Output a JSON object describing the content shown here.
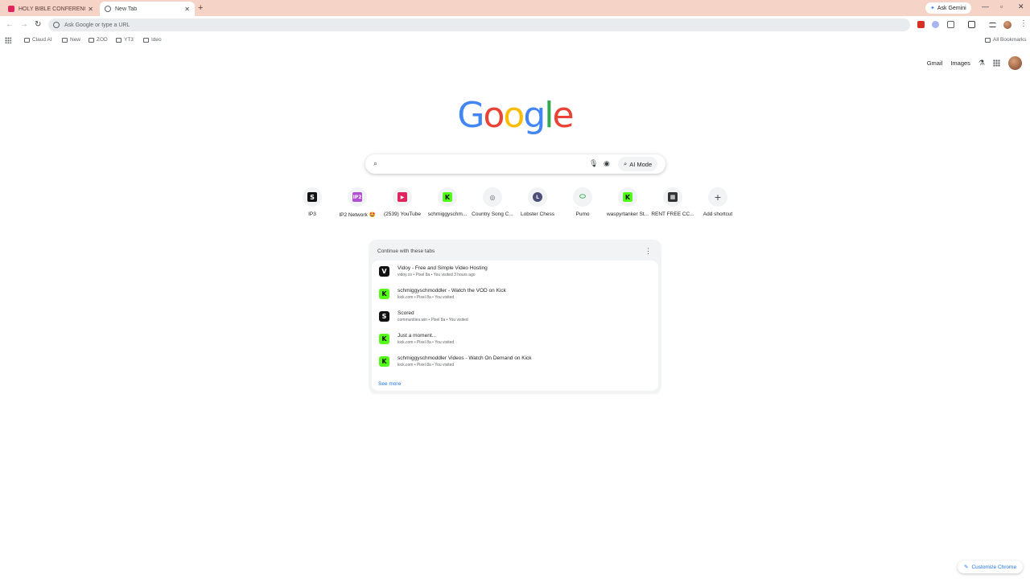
{
  "tabs": [
    {
      "title": "HOLY BIBLE CONFERENCE KJV",
      "icon": "youtube-icon",
      "active": false
    },
    {
      "title": "New Tab",
      "icon": "google-icon",
      "active": true
    }
  ],
  "gemini_label": "Ask Gemini",
  "omnibox": {
    "placeholder": "Ask Google or type a URL"
  },
  "bookmarks": [
    {
      "label": "Claud AI"
    },
    {
      "label": "New"
    },
    {
      "label": "ZOD"
    },
    {
      "label": "YT3"
    },
    {
      "label": "Ideo"
    }
  ],
  "all_bookmarks_label": "All Bookmarks",
  "header": {
    "gmail": "Gmail",
    "images": "Images"
  },
  "logo": [
    "G",
    "o",
    "o",
    "g",
    "l",
    "e"
  ],
  "search": {
    "placeholder": "",
    "ai_mode_label": "AI Mode"
  },
  "shortcuts": [
    {
      "label": "IP3",
      "icon": "S",
      "icon_color": "#111111"
    },
    {
      "label": "IP2 Network 🤩",
      "icon": "IP2",
      "icon_color": "#b04fd1"
    },
    {
      "label": "(2539) YouTube",
      "icon": "▶",
      "icon_color": "#e0245e"
    },
    {
      "label": "schmiggyschm...",
      "icon": "K",
      "icon_color": "#53fc18"
    },
    {
      "label": "Country Song C...",
      "icon": "◎",
      "icon_color": "#9aa0a6"
    },
    {
      "label": "Lobster Chess",
      "icon": "L",
      "icon_color": "#4b4f7a"
    },
    {
      "label": "Pumo",
      "icon": "💊",
      "icon_color": "#f1f3f4"
    },
    {
      "label": "waspyrtanker St...",
      "icon": "K",
      "icon_color": "#53fc18"
    },
    {
      "label": "RENT FREE CC...",
      "icon": "▦",
      "icon_color": "#333333"
    },
    {
      "label": "Add shortcut",
      "icon": "+",
      "icon_color": "#f1f3f4"
    }
  ],
  "continue_card": {
    "heading": "Continue with these tabs",
    "rows": [
      {
        "title": "Vidoy - Free and Simple Video Hosting",
        "sub": "vidoy.co • Pixel 8a • You visited 3 hours ago",
        "icon": "V",
        "icon_color": "#111111"
      },
      {
        "title": "schmiggyschmoddler - Watch the VOD on Kick",
        "sub": "kick.com • Pixel 8a • You visited",
        "icon": "K",
        "icon_color": "#53fc18"
      },
      {
        "title": "Scored",
        "sub": "communities.win • Pixel 8a • You visited",
        "icon": "S",
        "icon_color": "#111111"
      },
      {
        "title": "Just a moment...",
        "sub": "kick.com • Pixel 8a • You visited",
        "icon": "K",
        "icon_color": "#53fc18"
      },
      {
        "title": "schmiggyschmoddler Videos - Watch On Demand on Kick",
        "sub": "kick.com • Pixel 8a • You visited",
        "icon": "K",
        "icon_color": "#53fc18"
      }
    ],
    "see_more": "See more"
  },
  "customize_label": "Customize Chrome",
  "colors": {
    "tabstrip": "#f6d3c7",
    "accent": "#1a73e8",
    "kick_green": "#53fc18"
  }
}
